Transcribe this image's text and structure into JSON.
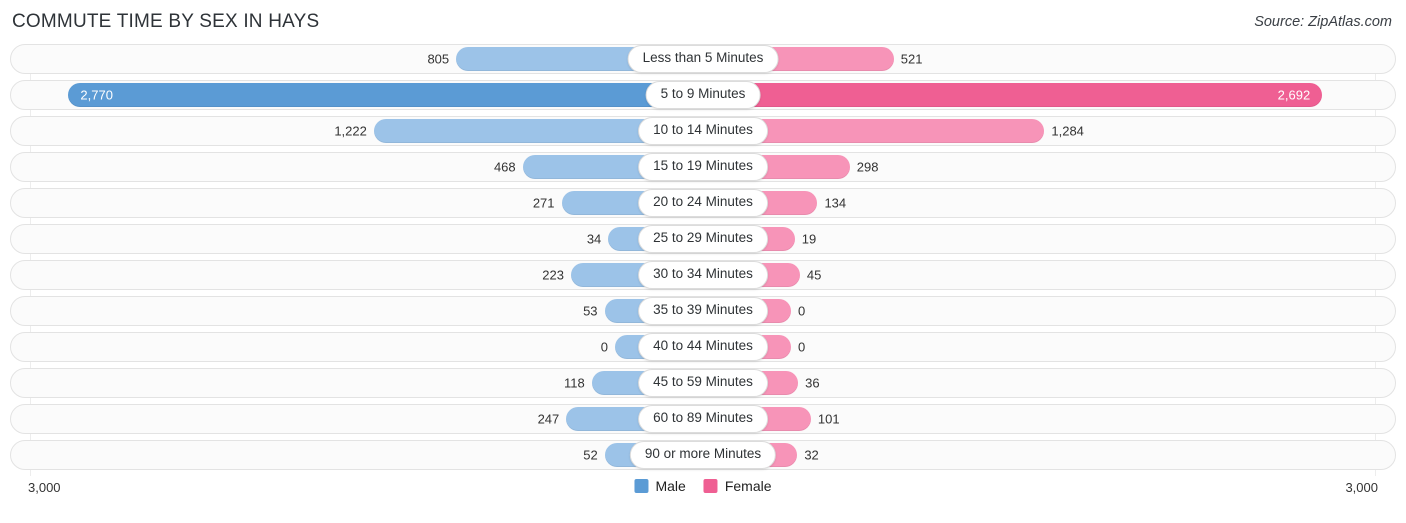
{
  "header": {
    "title": "COMMUTE TIME BY SEX IN HAYS",
    "source": "Source: ZipAtlas.com"
  },
  "legend": {
    "male_label": "Male",
    "female_label": "Female",
    "male_color": "#5b9bd5",
    "female_color": "#ef5f93",
    "male_color_light": "#9cc3e8",
    "female_color_light": "#f794b8"
  },
  "axis": {
    "left_label": "3,000",
    "right_label": "3,000",
    "max": 3000
  },
  "chart_data": {
    "type": "bar",
    "title": "COMMUTE TIME BY SEX IN HAYS",
    "subtitle": "Source: ZipAtlas.com",
    "orientation": "horizontal",
    "layout": "diverging-centered",
    "xlabel": "",
    "ylabel": "",
    "xlim": [
      -3000,
      3000
    ],
    "grid": false,
    "legend_position": "bottom-center",
    "categories": [
      "Less than 5 Minutes",
      "5 to 9 Minutes",
      "10 to 14 Minutes",
      "15 to 19 Minutes",
      "20 to 24 Minutes",
      "25 to 29 Minutes",
      "30 to 34 Minutes",
      "35 to 39 Minutes",
      "40 to 44 Minutes",
      "45 to 59 Minutes",
      "60 to 89 Minutes",
      "90 or more Minutes"
    ],
    "series": [
      {
        "name": "Male",
        "color": "#5b9bd5",
        "values": [
          805,
          2770,
          1222,
          468,
          271,
          34,
          223,
          53,
          0,
          118,
          247,
          52
        ],
        "labels": [
          "805",
          "2,770",
          "1,222",
          "468",
          "271",
          "34",
          "223",
          "53",
          "0",
          "118",
          "247",
          "52"
        ]
      },
      {
        "name": "Female",
        "color": "#ef5f93",
        "values": [
          521,
          2692,
          1284,
          298,
          134,
          19,
          45,
          0,
          0,
          36,
          101,
          32
        ],
        "labels": [
          "521",
          "2,692",
          "1,284",
          "298",
          "134",
          "19",
          "45",
          "0",
          "0",
          "36",
          "101",
          "32"
        ]
      }
    ]
  }
}
